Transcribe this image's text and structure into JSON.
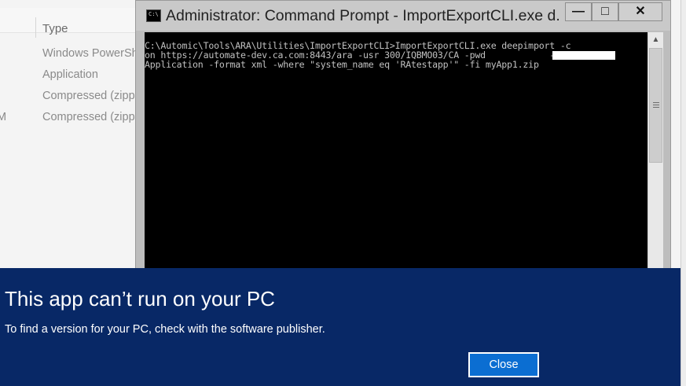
{
  "explorer": {
    "column_header": "Type",
    "rows": [
      {
        "tail": "",
        "type": "Windows PowerSh"
      },
      {
        "tail": "",
        "type": "Application"
      },
      {
        "tail": "",
        "type": "Compressed (zipp"
      },
      {
        "tail": "M",
        "type": "Compressed (zipp"
      }
    ]
  },
  "cmd": {
    "title": "Administrator: Command Prompt - ImportExportCLI.exe  d...",
    "icon": "cmd-icon",
    "icon_text": "C:\\",
    "minimize": "—",
    "maximize": "□",
    "close": "✕",
    "console_lines": [
      "C:\\Automic\\Tools\\ARA\\Utilities\\ImportExportCLI>ImportExportCLI.exe deepimport -c",
      "on https://automate-dev.ca.com:8443/ara -usr 300/IQBMO03/CA -pwd            -mt",
      "Application -format xml -where \"system_name eq 'RAtestapp'\" -fi myApp1.zip"
    ]
  },
  "banner": {
    "title": "This app can’t run on your PC",
    "message": "To find a version for your PC, check with the software publisher.",
    "close_label": "Close",
    "background": "#082866",
    "button_color": "#0b6ed2"
  }
}
